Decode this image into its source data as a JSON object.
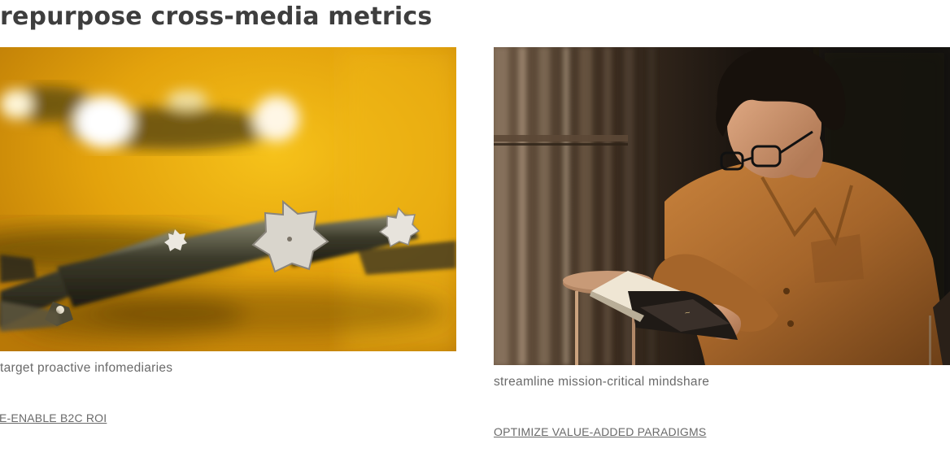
{
  "section": {
    "heading": "repurpose cross-media metrics"
  },
  "cards": [
    {
      "image_subject": "close-up of screwdriver bits on a yellow background",
      "caption": "target proactive infomediaries",
      "cta_label": "E-ENABLE B2C ROI"
    },
    {
      "image_subject": "young man in glasses reading a book by the window",
      "caption": "streamline mission-critical mindshare",
      "cta_label": "OPTIMIZE VALUE-ADDED PARADIGMS"
    }
  ],
  "colors": {
    "heading": "#3e3e3e",
    "caption": "#6a6a6a",
    "link": "#6a6a6a",
    "photo1_primary": "#e4a812",
    "photo2_primary": "#1e150d"
  }
}
